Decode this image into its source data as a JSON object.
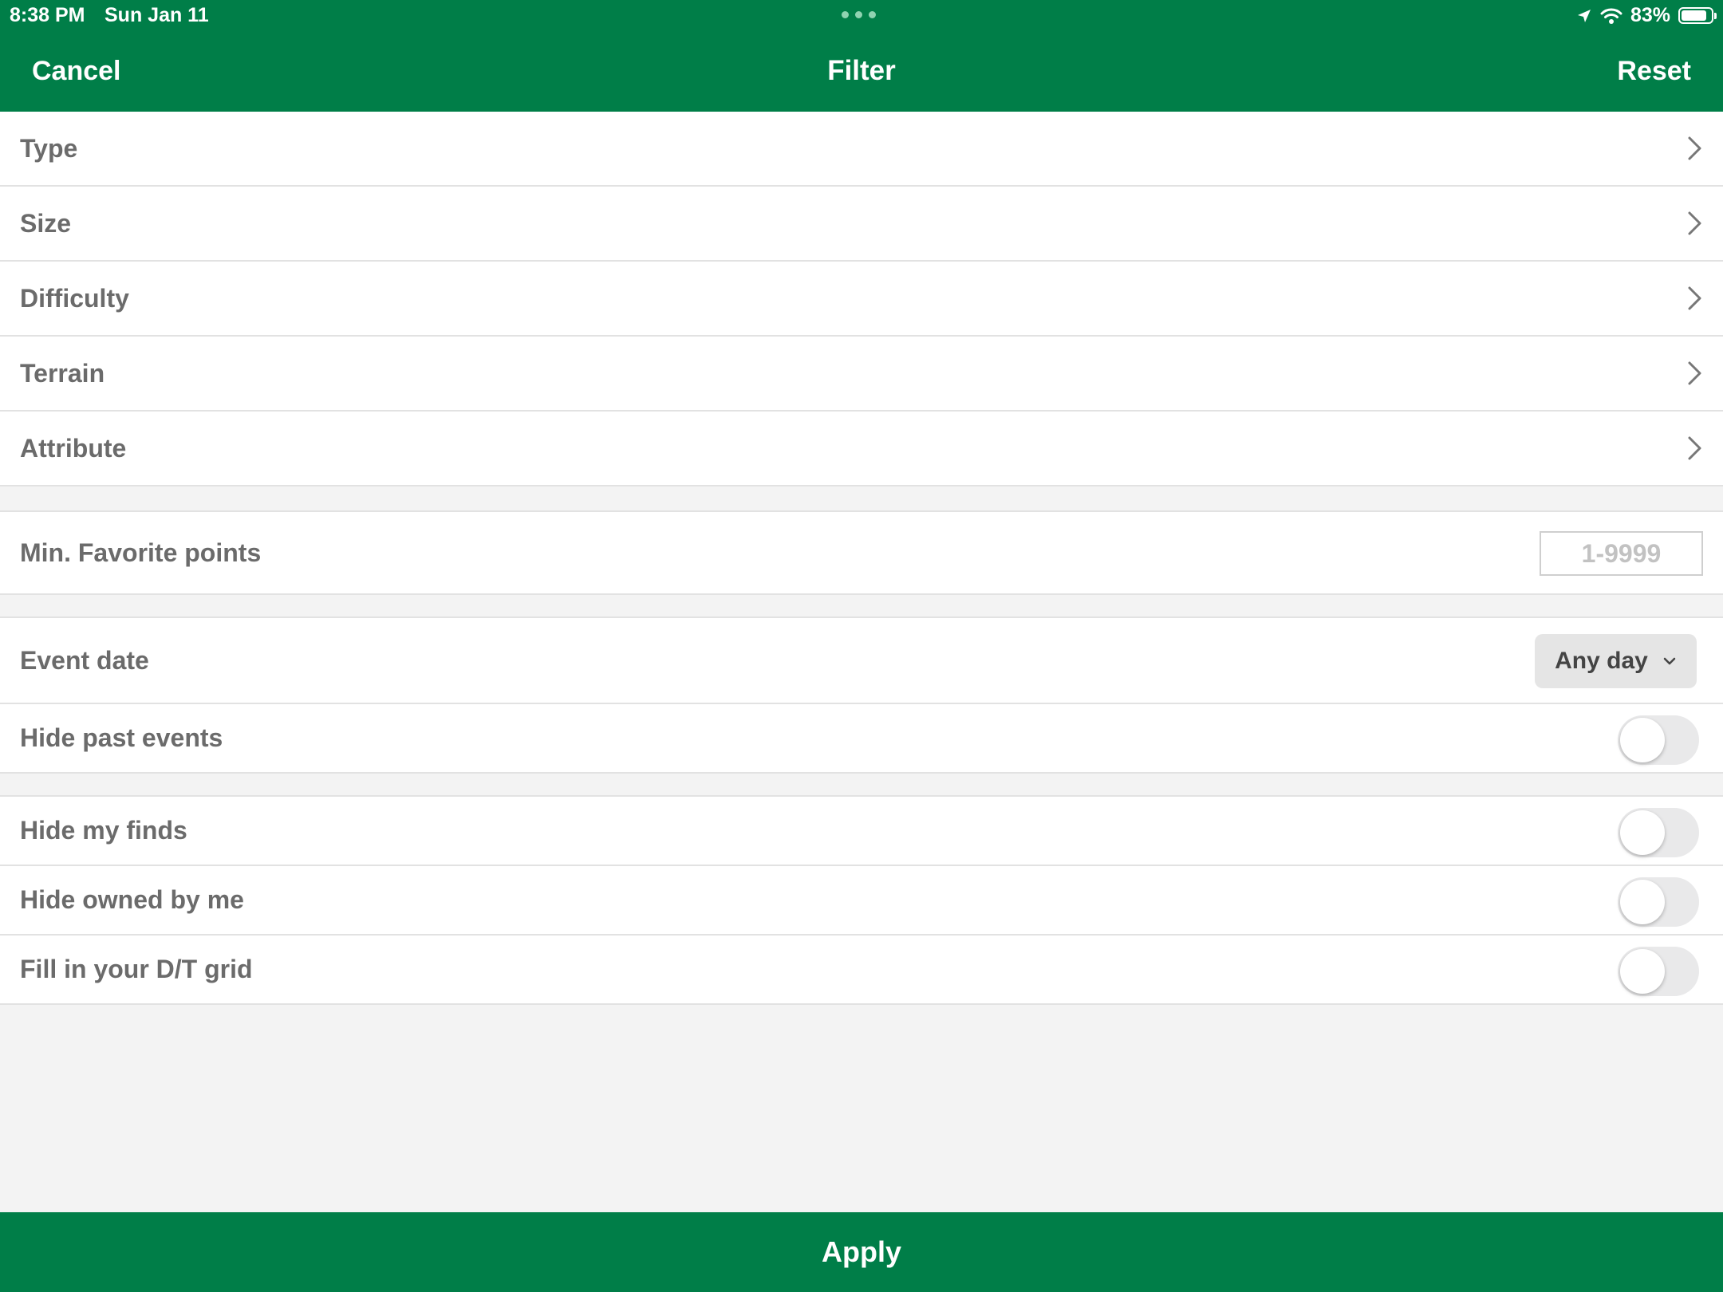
{
  "status_bar": {
    "time": "8:38 PM",
    "date": "Sun Jan 11",
    "battery_percent": "83%",
    "battery_level": 0.83,
    "icons": [
      "location-icon",
      "wifi-icon",
      "battery-icon"
    ]
  },
  "nav": {
    "cancel_label": "Cancel",
    "title": "Filter",
    "reset_label": "Reset"
  },
  "filters": {
    "type_label": "Type",
    "size_label": "Size",
    "difficulty_label": "Difficulty",
    "terrain_label": "Terrain",
    "attribute_label": "Attribute"
  },
  "favorite_points": {
    "label": "Min. Favorite points",
    "placeholder": "1-9999",
    "value": ""
  },
  "events": {
    "event_date_label": "Event date",
    "event_date_value": "Any day",
    "hide_past_label": "Hide past events",
    "hide_past_on": false
  },
  "personal": {
    "hide_finds_label": "Hide my finds",
    "hide_finds_on": false,
    "hide_owned_label": "Hide owned by me",
    "hide_owned_on": false,
    "dt_grid_label": "Fill in your D/T grid",
    "dt_grid_on": false
  },
  "apply_label": "Apply",
  "colors": {
    "brand_green": "#007e48",
    "background": "#f3f3f3",
    "label_text": "#6b6b6b"
  }
}
